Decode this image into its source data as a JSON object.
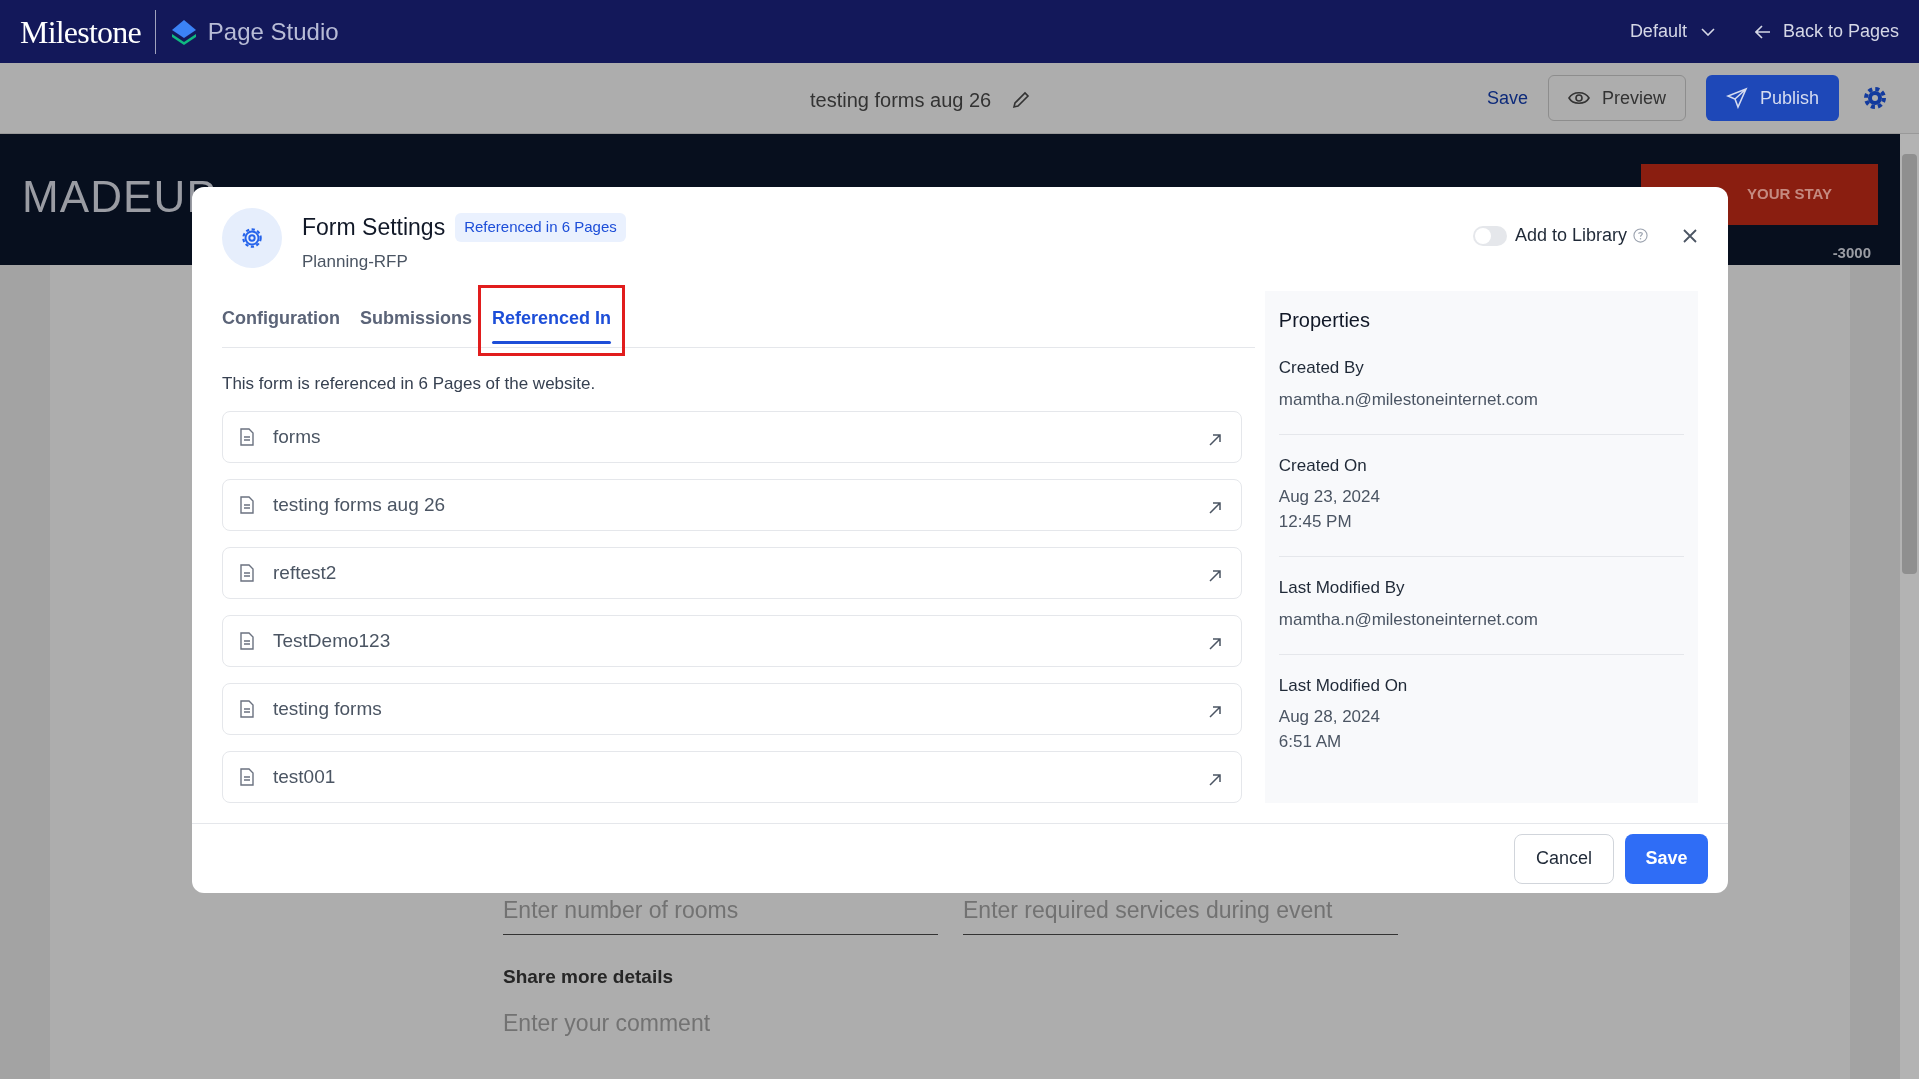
{
  "top_bar": {
    "logo": "Milestone",
    "product": "Page Studio",
    "theme_select": "Default",
    "back_link": "Back to Pages"
  },
  "toolbar": {
    "page_title": "testing forms aug 26",
    "save": "Save",
    "preview": "Preview",
    "publish": "Publish"
  },
  "background_page": {
    "brand": "MADEUP",
    "cta": "YOUR STAY",
    "phone": "-3000",
    "fields": [
      {
        "placeholder": "Enter number of rooms"
      },
      {
        "placeholder": "Enter required services during event"
      }
    ],
    "comment_label": "Share more details",
    "comment_placeholder": "Enter your comment"
  },
  "dialog": {
    "title": "Form Settings",
    "badge": "Referenced in 6 Pages",
    "subtitle": "Planning-RFP",
    "add_to_library": {
      "label": "Add to Library",
      "on": false
    },
    "tabs": [
      {
        "label": "Configuration",
        "selected": false
      },
      {
        "label": "Submissions",
        "selected": false
      },
      {
        "label": "Referenced In",
        "selected": true,
        "highlighted": true
      }
    ],
    "intro": "This form is referenced in 6 Pages of the website.",
    "pages": [
      {
        "name": "forms"
      },
      {
        "name": "testing forms aug 26"
      },
      {
        "name": "reftest2"
      },
      {
        "name": "TestDemo123"
      },
      {
        "name": "testing forms"
      },
      {
        "name": "test001"
      }
    ],
    "properties": {
      "title": "Properties",
      "items": [
        {
          "label": "Created By",
          "lines": [
            "mamtha.n@milestoneinternet.com"
          ]
        },
        {
          "label": "Created On",
          "lines": [
            "Aug 23, 2024",
            "12:45 PM"
          ]
        },
        {
          "label": "Last Modified By",
          "lines": [
            "mamtha.n@milestoneinternet.com"
          ]
        },
        {
          "label": "Last Modified On",
          "lines": [
            "Aug 28, 2024",
            "6:51 AM"
          ]
        }
      ]
    },
    "buttons": {
      "cancel": "Cancel",
      "save": "Save"
    }
  }
}
